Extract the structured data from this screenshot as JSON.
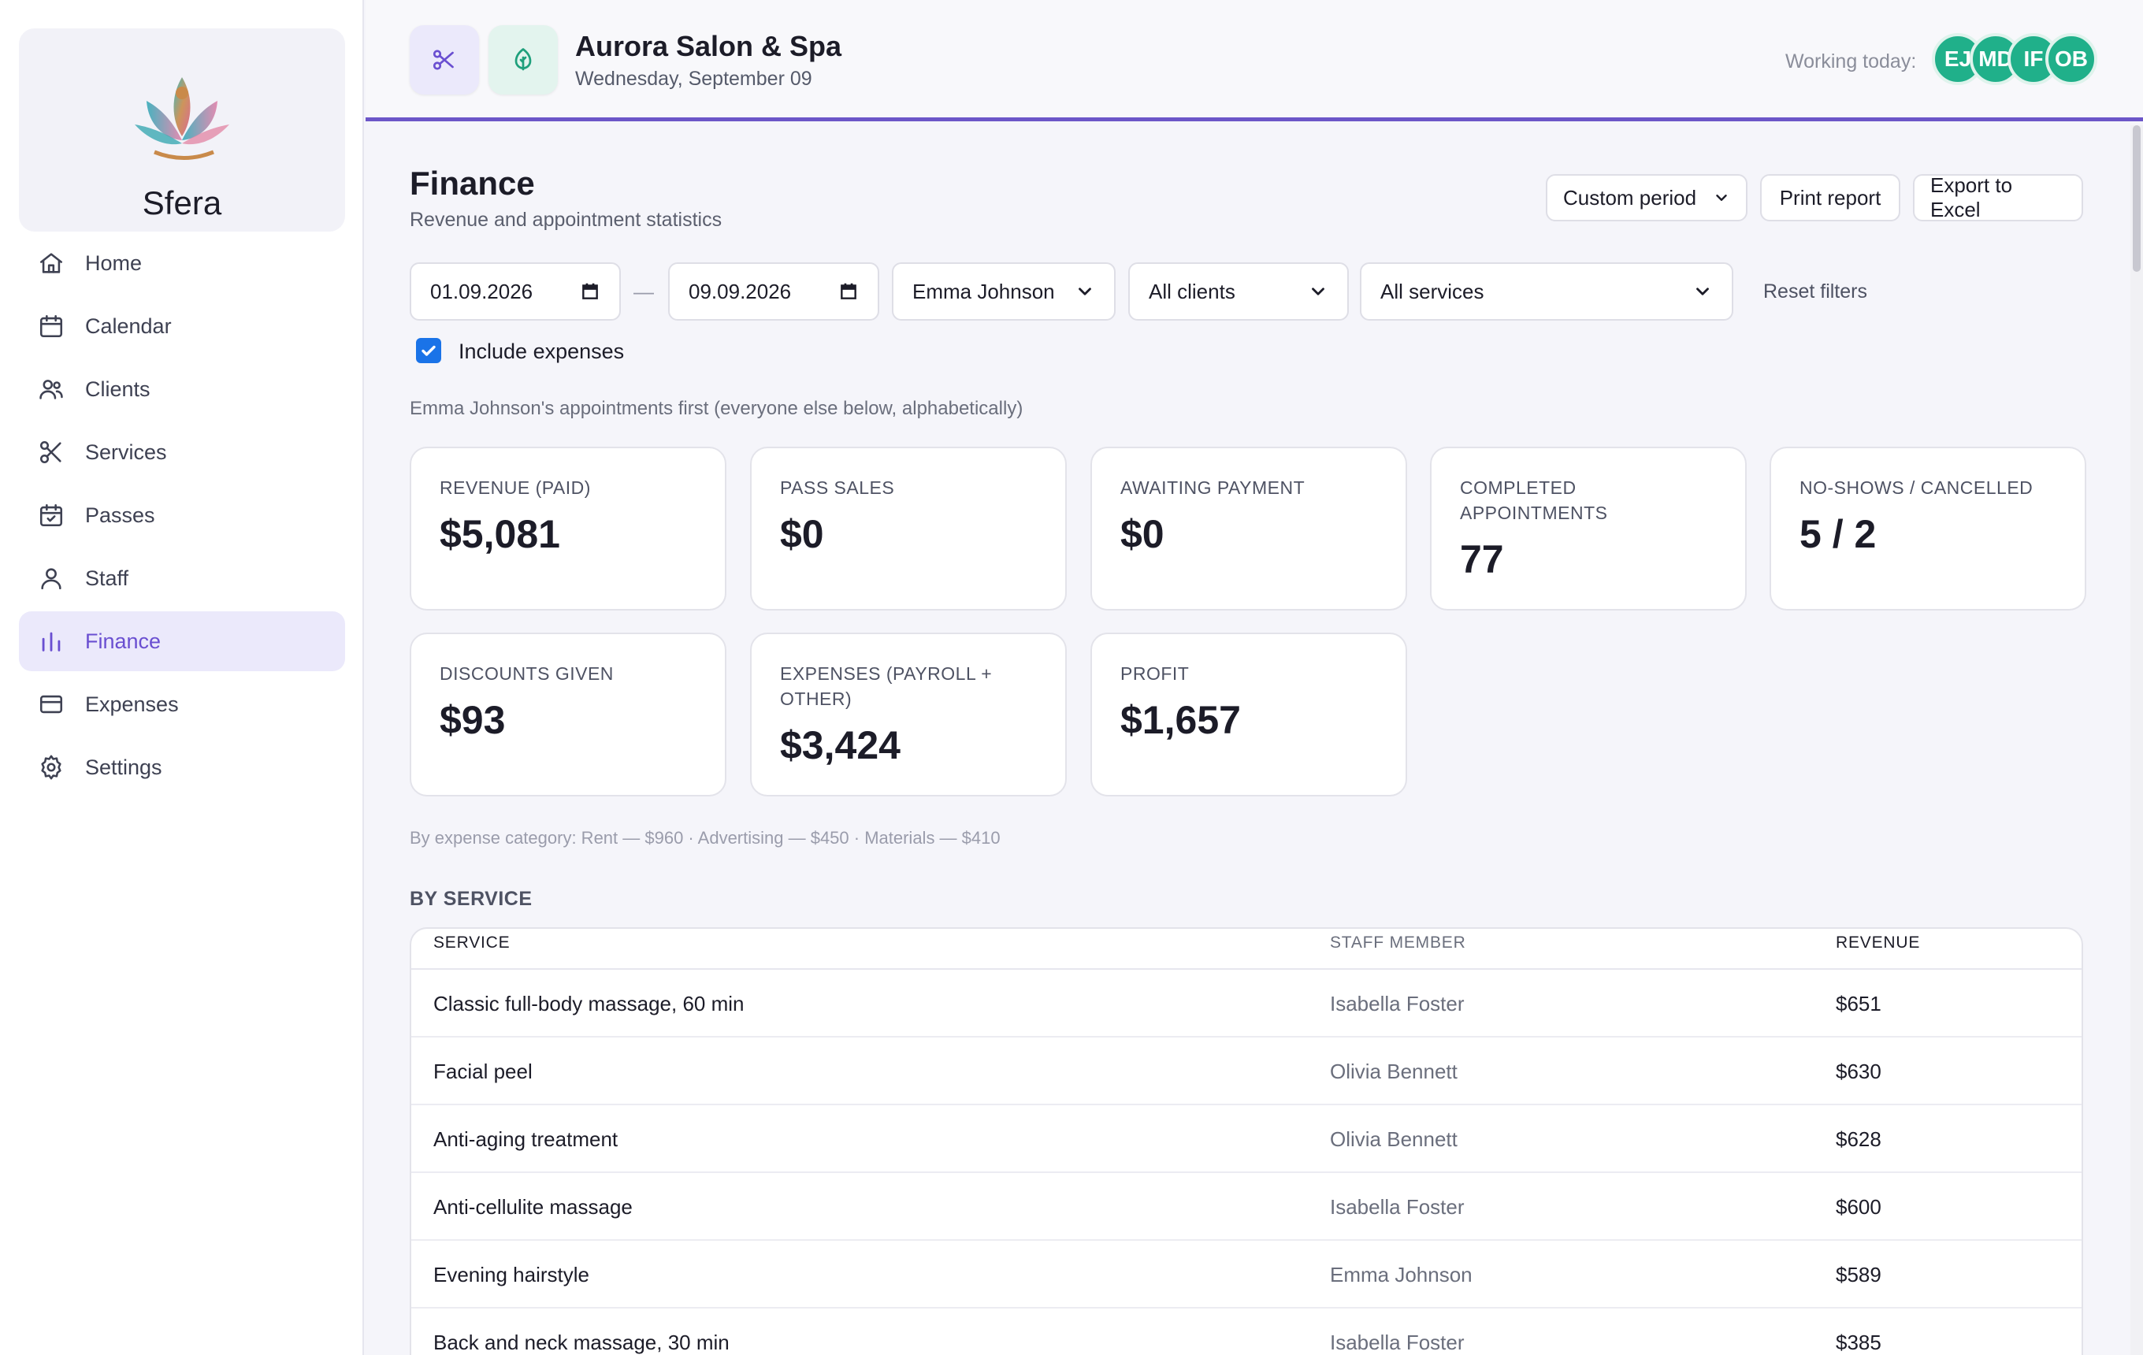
{
  "brand": {
    "name": "Sfera"
  },
  "sidebar": {
    "items": [
      {
        "label": "Home",
        "icon": "home-icon"
      },
      {
        "label": "Calendar",
        "icon": "calendar-icon"
      },
      {
        "label": "Clients",
        "icon": "users-icon"
      },
      {
        "label": "Services",
        "icon": "scissors-icon"
      },
      {
        "label": "Passes",
        "icon": "calendar-check-icon"
      },
      {
        "label": "Staff",
        "icon": "user-icon"
      },
      {
        "label": "Finance",
        "icon": "bar-chart-icon",
        "active": true
      },
      {
        "label": "Expenses",
        "icon": "credit-card-icon"
      },
      {
        "label": "Settings",
        "icon": "gear-icon"
      }
    ]
  },
  "header": {
    "salon_name": "Aurora Salon & Spa",
    "date": "Wednesday, September 09",
    "working_today_label": "Working today:",
    "staff_avatars": [
      "EJ",
      "MD",
      "IF",
      "OB"
    ],
    "accent_color": "#6c56c8"
  },
  "page": {
    "title": "Finance",
    "subtitle": "Revenue and appointment statistics",
    "actions": {
      "period": "Custom period",
      "print": "Print report",
      "export": "Export to Excel"
    }
  },
  "filters": {
    "date_from": "01.09.2026",
    "date_separator": "—",
    "date_to": "09.09.2026",
    "staff": "Emma Johnson",
    "clients": "All clients",
    "services": "All services",
    "reset": "Reset filters",
    "include_expenses_label": "Include expenses",
    "include_expenses": true
  },
  "hint": "Emma Johnson's appointments first (everyone else below, alphabetically)",
  "stats": [
    {
      "label": "REVENUE (PAID)",
      "value": "$5,081"
    },
    {
      "label": "PASS SALES",
      "value": "$0"
    },
    {
      "label": "AWAITING PAYMENT",
      "value": "$0"
    },
    {
      "label": "COMPLETED APPOINTMENTS",
      "value": "77"
    },
    {
      "label": "NO-SHOWS / CANCELLED",
      "value": "5 / 2"
    },
    {
      "label": "DISCOUNTS GIVEN",
      "value": "$93"
    },
    {
      "label": "EXPENSES (PAYROLL + OTHER)",
      "value": "$3,424"
    },
    {
      "label": "PROFIT",
      "value": "$1,657"
    }
  ],
  "expense_note": "By expense category: Rent — $960 · Advertising — $450 · Materials — $410",
  "by_service": {
    "title": "BY SERVICE",
    "columns": [
      "SERVICE",
      "STAFF MEMBER",
      "REVENUE"
    ],
    "rows": [
      {
        "service": "Classic full-body massage, 60 min",
        "staff": "Isabella Foster",
        "revenue": "$651"
      },
      {
        "service": "Facial peel",
        "staff": "Olivia Bennett",
        "revenue": "$630"
      },
      {
        "service": "Anti-aging treatment",
        "staff": "Olivia Bennett",
        "revenue": "$628"
      },
      {
        "service": "Anti-cellulite massage",
        "staff": "Isabella Foster",
        "revenue": "$600"
      },
      {
        "service": "Evening hairstyle",
        "staff": "Emma Johnson",
        "revenue": "$589"
      },
      {
        "service": "Back and neck massage, 30 min",
        "staff": "Isabella Foster",
        "revenue": "$385"
      }
    ]
  }
}
